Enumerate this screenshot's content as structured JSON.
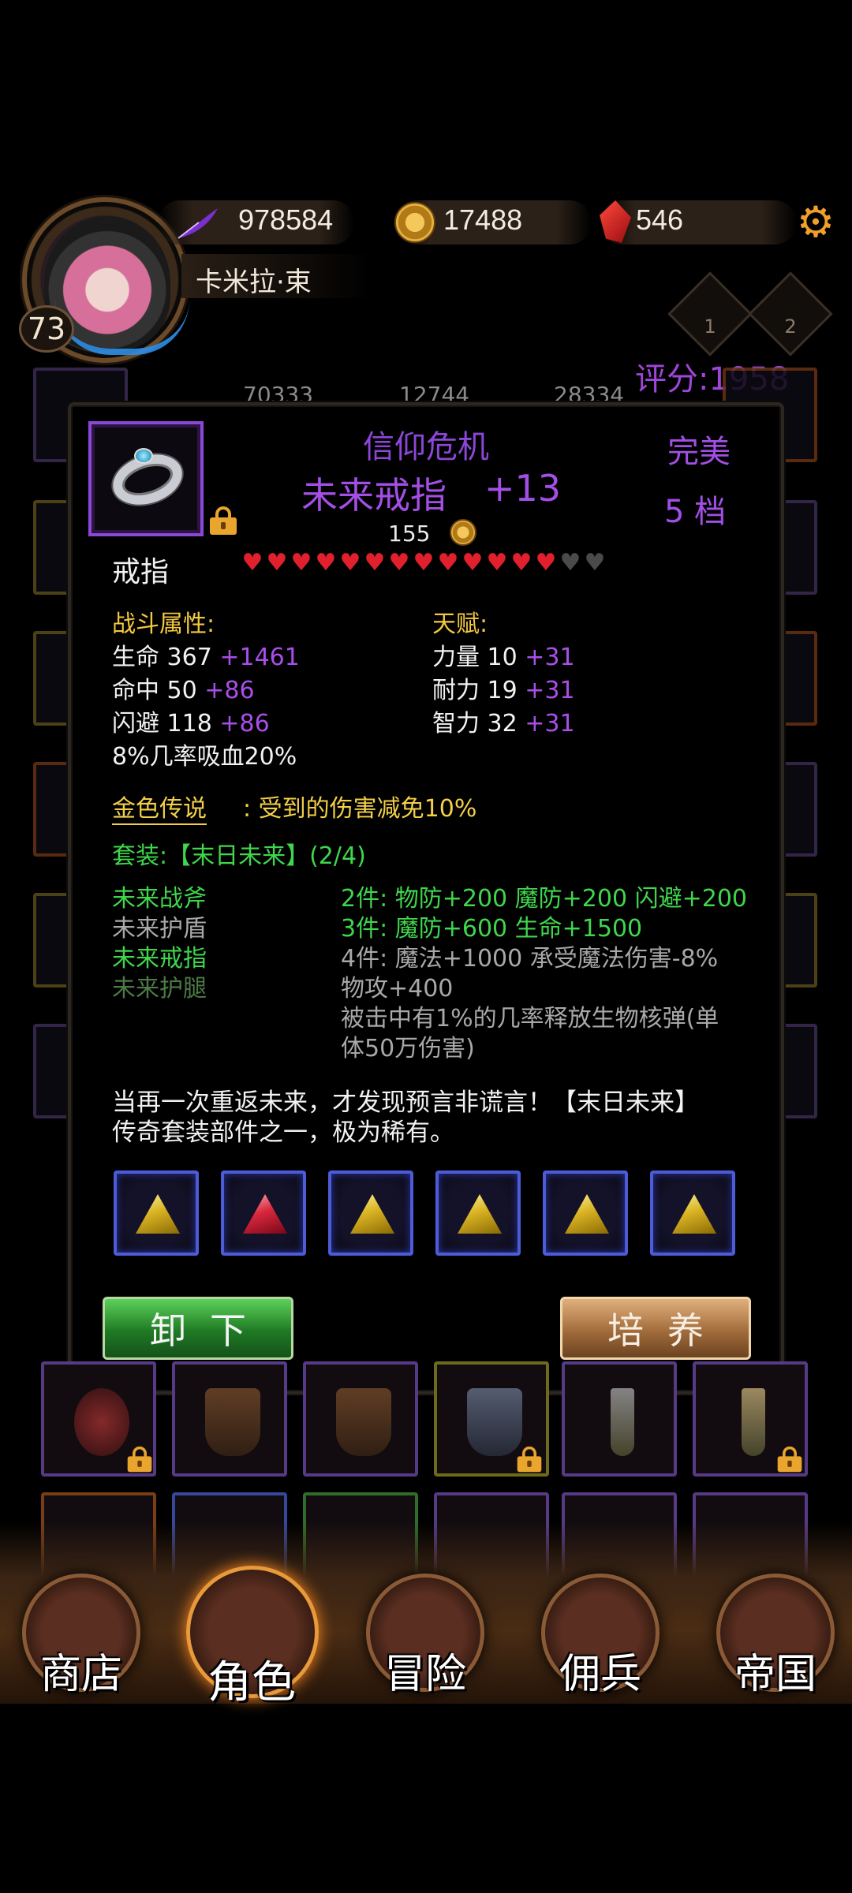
{
  "header": {
    "player_level": "73",
    "player_name": "卡米拉·束",
    "resources": {
      "feather_amount": "978584",
      "gold_amount": "17488",
      "gem_amount": "546"
    },
    "ranks": [
      "1",
      "2"
    ],
    "score": "评分:1958",
    "bg_stats": [
      "70333",
      "12744",
      "28334"
    ]
  },
  "item": {
    "set_name": "信仰危机",
    "name": "未来戒指",
    "enhance": "+13",
    "price": "155",
    "quality": "完美",
    "tier": "5 档",
    "type": "戒指",
    "stars_filled": 13,
    "stars_total": 15,
    "combat_title": "战斗属性:",
    "combat": [
      {
        "label": "生命 367",
        "bonus": "+1461"
      },
      {
        "label": "命中 50",
        "bonus": "+86"
      },
      {
        "label": "闪避 118",
        "bonus": "+86"
      },
      {
        "label": "8%几率吸血20%",
        "bonus": ""
      }
    ],
    "talent_title": "天赋:",
    "talent": [
      {
        "label": "力量 10",
        "bonus": "+31"
      },
      {
        "label": "耐力 19",
        "bonus": "+31"
      },
      {
        "label": "智力 32",
        "bonus": "+31"
      }
    ],
    "legend_title": "金色传说",
    "legend_desc": ": 受到的伤害减免10%",
    "set_title": "套装:【末日未来】(2/4)",
    "set_pieces": [
      {
        "name": "未来战斧",
        "state": "owned"
      },
      {
        "name": "未来护盾",
        "state": "missing"
      },
      {
        "name": "未来戒指",
        "state": "owned"
      },
      {
        "name": "未来护腿",
        "state": "dim"
      }
    ],
    "set_bonuses": [
      {
        "text": "2件: 物防+200 魔防+200 闪避+200",
        "active": true
      },
      {
        "text": "3件: 魔防+600 生命+1500",
        "active": true
      },
      {
        "text": "4件: 魔法+1000 承受魔法伤害-8%",
        "active": false
      },
      {
        "text": "物攻+400",
        "active": false
      },
      {
        "text": "被击中有1%的几率释放生物核弹(单",
        "active": false
      },
      {
        "text": "体50万伤害)",
        "active": false
      }
    ],
    "lore": [
      "当再一次重返未来，才发现预言非谎言！【末日未来】",
      "传奇套装部件之一，极为稀有。"
    ],
    "sockets": [
      "gold",
      "red",
      "gold",
      "gold",
      "gold",
      "gold"
    ]
  },
  "actions": {
    "unequip": "卸下",
    "train": "培养"
  },
  "nav": {
    "shop": "商店",
    "character": "角色",
    "adventure": "冒险",
    "mercenary": "佣兵",
    "empire": "帝国"
  },
  "colors": {
    "purple_quality": "#a34fe6",
    "set_green": "#3fd64c",
    "legend_gold": "#f3d047"
  }
}
